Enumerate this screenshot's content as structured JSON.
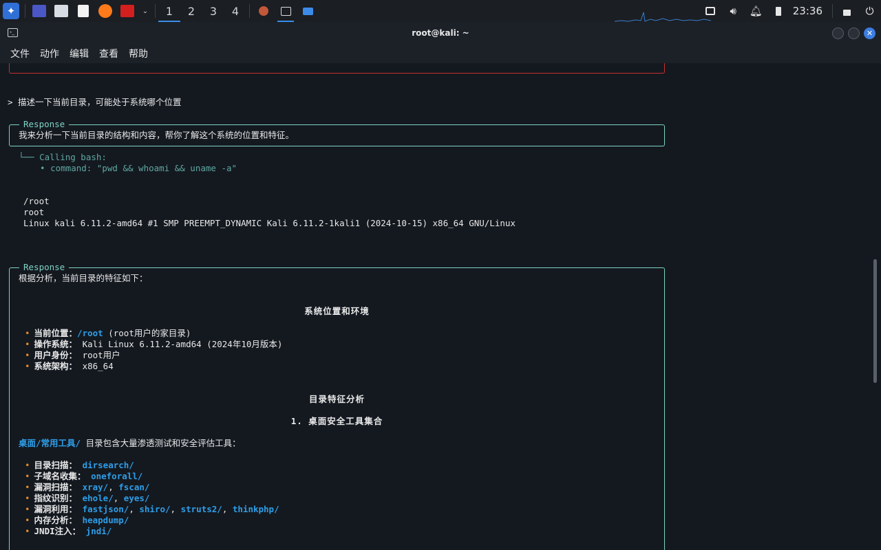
{
  "panel": {
    "workspaces": [
      "1",
      "2",
      "3",
      "4"
    ],
    "clock": "23:36"
  },
  "window": {
    "title": "root@kali: ~",
    "menu": [
      "文件",
      "动作",
      "编辑",
      "查看",
      "帮助"
    ]
  },
  "terminal": {
    "prompt_line": "> 描述一下当前目录，可能处于系统哪个位置",
    "response1": {
      "legend": "Response",
      "text": "我来分析一下当前目录的结构和内容，帮你了解这个系统的位置和特征。"
    },
    "tool_call": {
      "header": "└── Calling bash:",
      "command": "  • command: \"pwd && whoami && uname -a\""
    },
    "output": [
      "/root",
      "root",
      "Linux kali 6.11.2-amd64 #1 SMP PREEMPT_DYNAMIC Kali 6.11.2-1kali1 (2024-10-15) x86_64 GNU/Linux"
    ],
    "response2": {
      "legend": "Response",
      "intro": "根据分析，当前目录的特征如下：",
      "heading1": "系统位置和环境",
      "env_items": [
        {
          "label": "当前位置：",
          "value": "/root",
          "rest": " (root用户的家目录)"
        },
        {
          "label": "操作系统：",
          "value": "",
          "rest": " Kali Linux 6.11.2-amd64 (2024年10月版本)"
        },
        {
          "label": "用户身份：",
          "value": "",
          "rest": " root用户"
        },
        {
          "label": "系统架构：",
          "value": "",
          "rest": " x86_64"
        }
      ],
      "heading2": "目录特征分析",
      "heading3": "1. 桌面安全工具集合",
      "tools_intro_link": "桌面/常用工具/",
      "tools_intro_rest": " 目录包含大量渗透测试和安全评估工具：",
      "tool_items": [
        {
          "label": "目录扫描：",
          "values": [
            "dirsearch/"
          ]
        },
        {
          "label": "子域名收集：",
          "values": [
            "oneforall/"
          ]
        },
        {
          "label": "漏洞扫描：",
          "values": [
            "xray/",
            "fscan/"
          ]
        },
        {
          "label": "指纹识别：",
          "values": [
            "ehole/",
            "eyes/"
          ]
        },
        {
          "label": "漏洞利用：",
          "values": [
            "fastjson/",
            "shiro/",
            "struts2/",
            "thinkphp/"
          ]
        },
        {
          "label": "内存分析：",
          "values": [
            "heapdump/"
          ]
        },
        {
          "label": "JNDI注入：",
          "values": [
            "jndi/"
          ]
        }
      ]
    }
  },
  "colors": {
    "accent": "#3b8eea",
    "box_border": "#7fd4c1",
    "link": "#2e9ee8",
    "bullet": "#e08a2a",
    "error_border": "#c8302e"
  }
}
